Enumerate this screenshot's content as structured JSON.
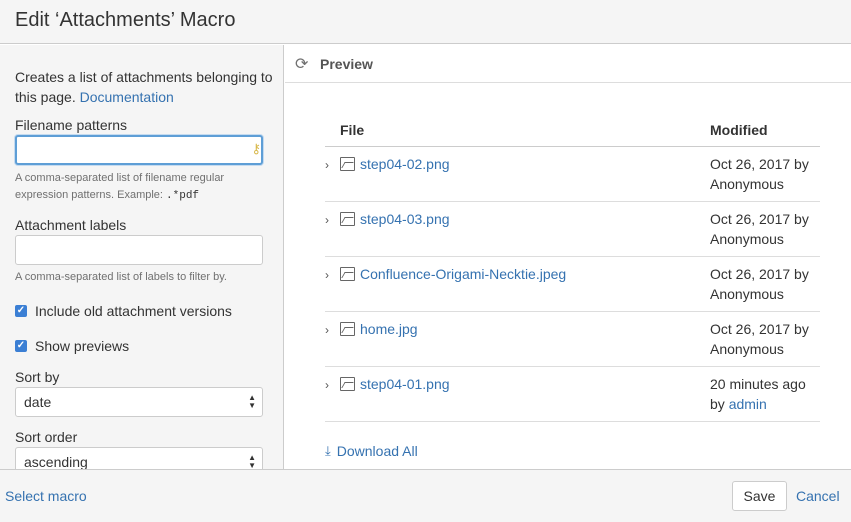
{
  "dialog": {
    "title": "Edit ‘Attachments’ Macro"
  },
  "left": {
    "description": "Creates a list of attachments belonging to this page.",
    "doc_link": "Documentation",
    "filename_label": "Filename patterns",
    "filename_value": "",
    "filename_help": "A comma-separated list of filename regular expression patterns. Example:",
    "filename_example": ".*pdf",
    "labels_label": "Attachment labels",
    "labels_value": "",
    "labels_help": "A comma-separated list of labels to filter by.",
    "include_old_label": "Include old attachment versions",
    "include_old_checked": true,
    "show_previews_label": "Show previews",
    "show_previews_checked": true,
    "sort_by_label": "Sort by",
    "sort_by_value": "date",
    "sort_order_label": "Sort order",
    "sort_order_value": "ascending"
  },
  "preview": {
    "title": "Preview",
    "col_file": "File",
    "col_modified": "Modified",
    "rows": [
      {
        "file": "step04-02.png",
        "date": "Oct 26, 2017 by",
        "by": "Anonymous",
        "by_link": false
      },
      {
        "file": "step04-03.png",
        "date": "Oct 26, 2017 by",
        "by": "Anonymous",
        "by_link": false
      },
      {
        "file": "Confluence-Origami-Necktie.jpeg",
        "date": "Oct 26, 2017 by",
        "by": "Anonymous",
        "by_link": false
      },
      {
        "file": "home.jpg",
        "date": "Oct 26, 2017 by",
        "by": "Anonymous",
        "by_link": false
      },
      {
        "file": "step04-01.png",
        "date": "20 minutes ago",
        "by_prefix": "by",
        "by": "admin",
        "by_link": true
      }
    ],
    "download_all": "Download All"
  },
  "footer": {
    "select_macro": "Select macro",
    "save": "Save",
    "cancel": "Cancel"
  }
}
